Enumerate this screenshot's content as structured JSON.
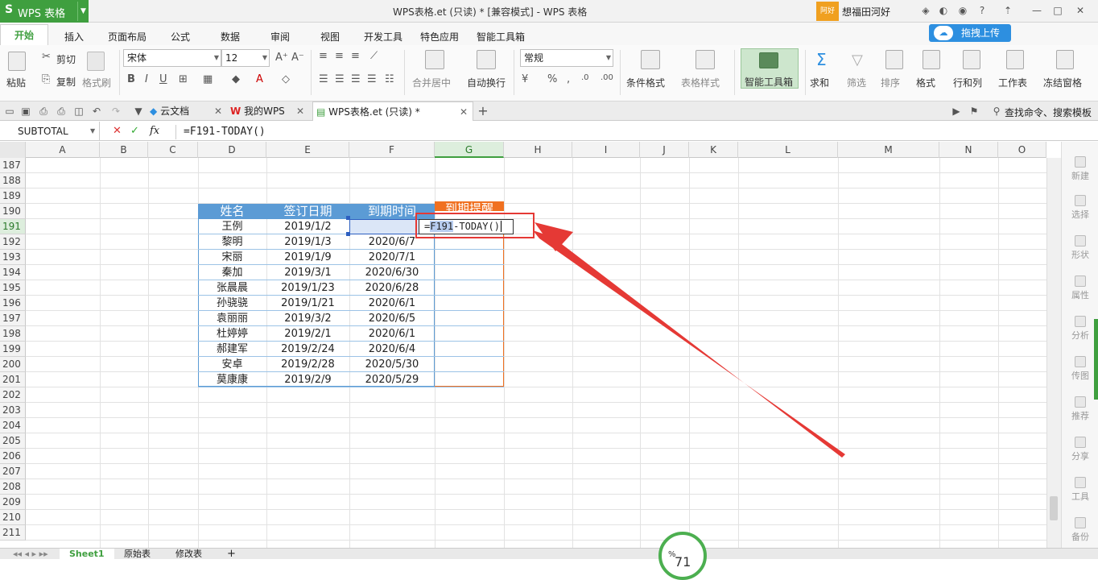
{
  "app": {
    "name": "WPS 表格",
    "logo": "S"
  },
  "window": {
    "title": "WPS表格.et (只读) * [兼容模式] - WPS 表格",
    "user_badge": "阿好",
    "user_name": "想福田河好"
  },
  "menu": {
    "items": [
      "开始",
      "插入",
      "页面布局",
      "公式",
      "数据",
      "审阅",
      "视图",
      "开发工具",
      "特色应用",
      "智能工具箱"
    ],
    "upload": "拖拽上传"
  },
  "ribbon": {
    "paste": "粘贴",
    "cut": "剪切",
    "copy": "复制",
    "format_painter": "格式刷",
    "font_name": "宋体",
    "font_size": "12",
    "merge_center": "合并居中",
    "wrap_text": "自动换行",
    "number_format": "常规",
    "cond_format": "条件格式",
    "table_style": "表格样式",
    "smart_toolbox": "智能工具箱",
    "sum": "求和",
    "filter": "筛选",
    "sort": "排序",
    "format": "格式",
    "row_col": "行和列",
    "worksheet": "工作表",
    "freeze": "冻结窗格"
  },
  "tabs": {
    "items": [
      "云文档",
      "我的WPS",
      "WPS表格.et (只读) *"
    ],
    "search": "查找命令、搜索模板"
  },
  "formula": {
    "name_box": "SUBTOTAL",
    "fx": "fx",
    "content": "=F191-TODAY()"
  },
  "columns": [
    "A",
    "B",
    "C",
    "D",
    "E",
    "F",
    "G",
    "H",
    "I",
    "J",
    "K",
    "L",
    "M",
    "N",
    "O"
  ],
  "rows": [
    "187",
    "188",
    "189",
    "190",
    "191",
    "192",
    "193",
    "194",
    "195",
    "196",
    "197",
    "198",
    "199",
    "200",
    "201",
    "202",
    "203",
    "204",
    "205",
    "206",
    "207",
    "208",
    "209",
    "210",
    "211"
  ],
  "table": {
    "headers": [
      "姓名",
      "签订日期",
      "到期时间",
      "到期提醒"
    ],
    "rows": [
      [
        "王例",
        "2019/1/2",
        ""
      ],
      [
        "黎明",
        "2019/1/3",
        "2020/6/7"
      ],
      [
        "宋丽",
        "2019/1/9",
        "2020/7/1"
      ],
      [
        "秦加",
        "2019/3/1",
        "2020/6/30"
      ],
      [
        "张晨晨",
        "2019/1/23",
        "2020/6/28"
      ],
      [
        "孙骁骁",
        "2019/1/21",
        "2020/6/1"
      ],
      [
        "袁丽丽",
        "2019/3/2",
        "2020/6/5"
      ],
      [
        "杜婷婷",
        "2019/2/1",
        "2020/6/1"
      ],
      [
        "郝建军",
        "2019/2/24",
        "2020/6/4"
      ],
      [
        "安卓",
        "2019/2/28",
        "2020/5/30"
      ],
      [
        "莫康康",
        "2019/2/9",
        "2020/5/29"
      ]
    ]
  },
  "edit_cell": {
    "eq": "=",
    "ref": "F191",
    "rest": "-TODAY()"
  },
  "right_panel": [
    "新建",
    "选择",
    "形状",
    "属性",
    "分析",
    "传图",
    "推荐",
    "分享",
    "工具",
    "备份"
  ],
  "sheets": [
    "Sheet1",
    "原始表",
    "修改表"
  ],
  "zoom": {
    "value": "71",
    "unit": "%"
  },
  "colors": {
    "accent": "#3f9f3f",
    "header_blue": "#5b9bd5",
    "highlight_red": "#e53935"
  }
}
